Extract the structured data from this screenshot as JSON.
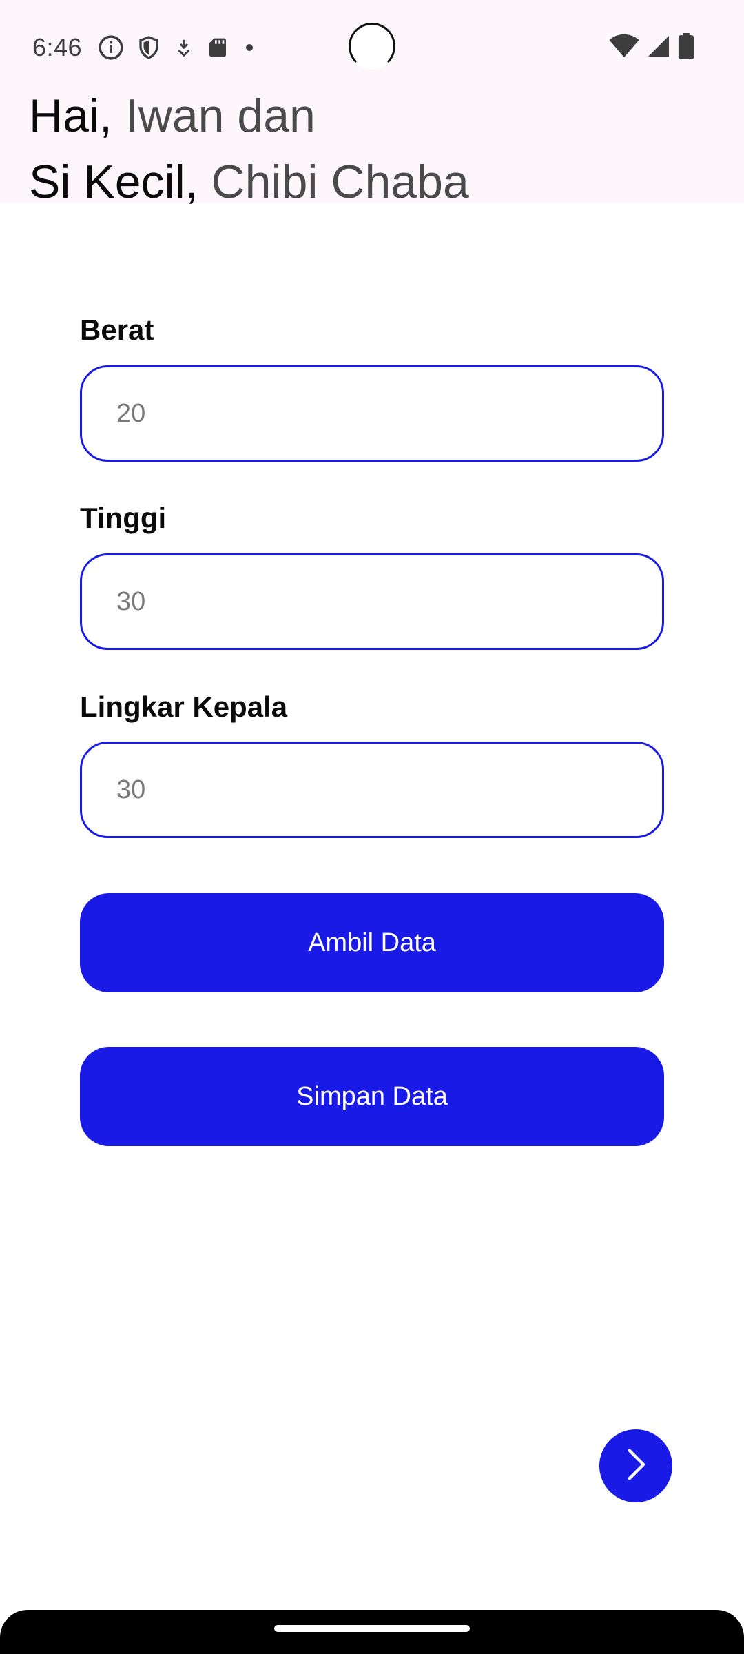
{
  "status_bar": {
    "time": "6:46",
    "left_icons": [
      "info-icon",
      "shield-icon",
      "download-icon",
      "sd-card-icon",
      "dot-icon"
    ],
    "right_icons": [
      "wifi-icon",
      "cellular-icon",
      "battery-icon"
    ]
  },
  "greeting": {
    "hai_label": "Hai,",
    "parent_name": "Iwan dan",
    "child_label": "Si Kecil,",
    "child_name": "Chibi Chaba"
  },
  "form": {
    "weight": {
      "label": "Berat",
      "value": "20"
    },
    "height": {
      "label": "Tinggi",
      "value": "30"
    },
    "head_circumference": {
      "label": "Lingkar Kepala",
      "value": "30"
    }
  },
  "buttons": {
    "fetch_label": "Ambil Data",
    "save_label": "Simpan Data"
  },
  "fab_icon": "chevron-right-icon",
  "colors": {
    "accent": "#1a1ae6",
    "header_bg": "#fdf7fb"
  }
}
